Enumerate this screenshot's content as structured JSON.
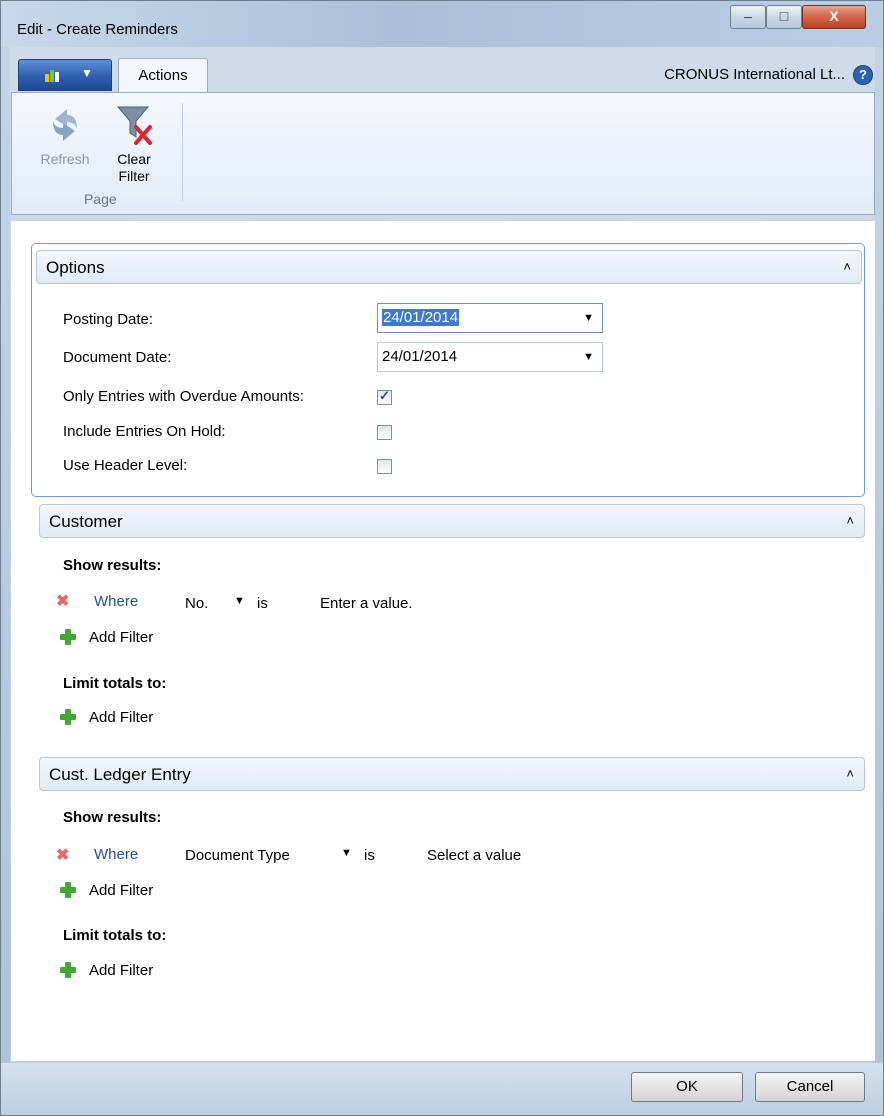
{
  "window": {
    "title": "Edit - Create Reminders",
    "controls": {
      "minimize": "–",
      "maximize": "□",
      "close": "X"
    }
  },
  "ribbon": {
    "tab_label": "Actions",
    "company": "CRONUS International Lt...",
    "help_glyph": "?",
    "buttons": [
      {
        "label": "Refresh",
        "icon": "refresh-icon",
        "enabled": false
      },
      {
        "label": "Clear Filter",
        "icon": "clear-filter-icon",
        "enabled": true
      }
    ],
    "group_label": "Page"
  },
  "options": {
    "header": "Options",
    "caret": "˄",
    "posting_date_label": "Posting Date:",
    "posting_date_value": "24/01/2014",
    "document_date_label": "Document Date:",
    "document_date_value": "24/01/2014",
    "dropdown_arrow": "▼",
    "only_overdue_label": "Only Entries with Overdue Amounts:",
    "only_overdue_checked": true,
    "include_on_hold_label": "Include Entries On Hold:",
    "include_on_hold_checked": false,
    "use_header_level_label": "Use Header Level:",
    "use_header_level_checked": false
  },
  "customer": {
    "header": "Customer",
    "show_results": "Show results:",
    "where": "Where",
    "field": "No.",
    "operator": "is",
    "value": "Enter a value.",
    "add_filter": "Add Filter",
    "limit_totals": "Limit totals to:",
    "add_filter_2": "Add Filter"
  },
  "ledger": {
    "header": "Cust. Ledger Entry",
    "show_results": "Show results:",
    "where": "Where",
    "field": "Document Type",
    "operator": "is",
    "value": "Select a value",
    "add_filter": "Add Filter",
    "limit_totals": "Limit totals to:",
    "add_filter_2": "Add Filter"
  },
  "footer": {
    "ok": "OK",
    "cancel": "Cancel"
  },
  "colors": {
    "accent": "#2d5fb0",
    "focus_border": "#6f9ad8",
    "link": "#1f4fa0",
    "add_green": "#43a831",
    "remove_red": "#e06b6b"
  }
}
